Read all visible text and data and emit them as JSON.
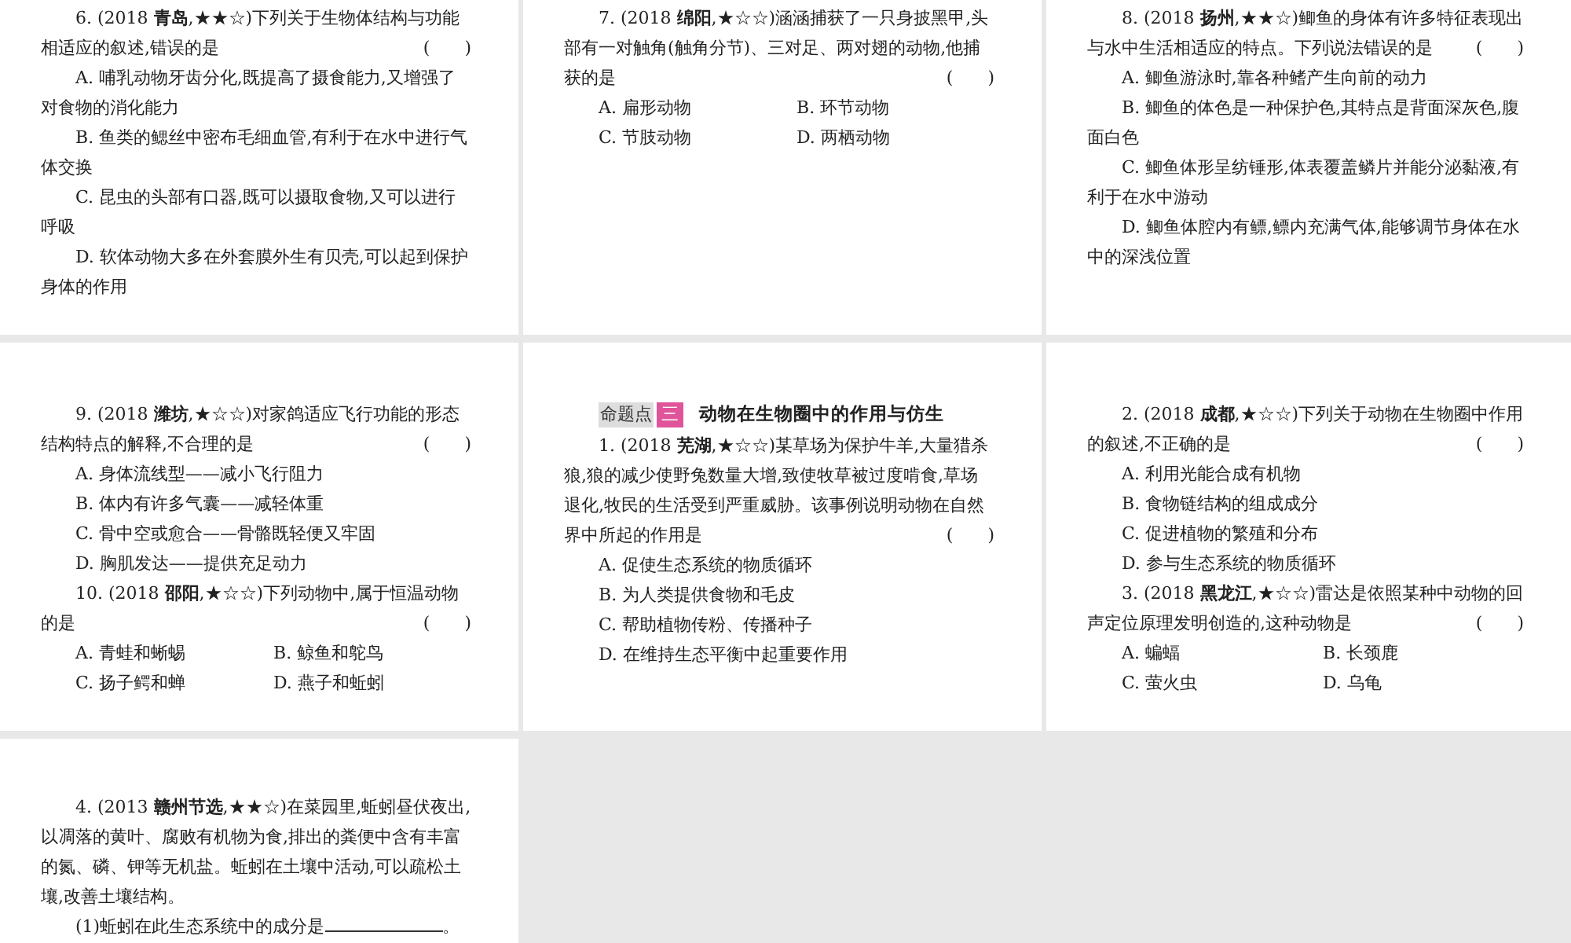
{
  "slides": [
    {
      "items": [
        {
          "kind": "question",
          "text": "6. (2018 **青岛**,★★☆)下列关于生物体结构与功能相适应的叙述,错误的是",
          "bracket": "(　　)"
        },
        {
          "kind": "option",
          "text": "A. 哺乳动物牙齿分化,既提高了摄食能力,又增强了对食物的消化能力"
        },
        {
          "kind": "option",
          "text": "B. 鱼类的鳃丝中密布毛细血管,有利于在水中进行气体交换"
        },
        {
          "kind": "option",
          "text": "C. 昆虫的头部有口器,既可以摄取食物,又可以进行呼吸"
        },
        {
          "kind": "option",
          "text": "D. 软体动物大多在外套膜外生有贝壳,可以起到保护身体的作用"
        }
      ]
    },
    {
      "items": [
        {
          "kind": "question",
          "text": "7. (2018 **绵阳**,★☆☆)涵涵捕获了一只身披黑甲,头部有一对触角(触角分节)、三对足、两对翅的动物,他捕获的是",
          "bracket": "(　　)"
        },
        {
          "kind": "option_pair",
          "left": "A. 扁形动物",
          "right": "B. 环节动物"
        },
        {
          "kind": "option_pair",
          "left": "C. 节肢动物",
          "right": "D. 两栖动物"
        }
      ]
    },
    {
      "items": [
        {
          "kind": "question",
          "text": "8. (2018 **扬州**,★★☆)鲫鱼的身体有许多特征表现出与水中生活相适应的特点。下列说法错误的是",
          "bracket": "(　　)"
        },
        {
          "kind": "option",
          "text": "A. 鲫鱼游泳时,靠各种鳍产生向前的动力"
        },
        {
          "kind": "option",
          "text": "B. 鲫鱼的体色是一种保护色,其特点是背面深灰色,腹面白色"
        },
        {
          "kind": "option",
          "text": "C. 鲫鱼体形呈纺锤形,体表覆盖鳞片并能分泌黏液,有利于在水中游动"
        },
        {
          "kind": "option",
          "text": "D. 鲫鱼体腔内有鳔,鳔内充满气体,能够调节身体在水中的深浅位置"
        }
      ]
    },
    {
      "items": [
        {
          "kind": "question",
          "text": "9. (2018 **潍坊**,★☆☆)对家鸽适应飞行功能的形态结构特点的解释,不合理的是",
          "bracket": "(　　)"
        },
        {
          "kind": "option",
          "text": "A. 身体流线型——减小飞行阻力"
        },
        {
          "kind": "option",
          "text": "B. 体内有许多气囊——减轻体重"
        },
        {
          "kind": "option",
          "text": "C. 骨中空或愈合——骨骼既轻便又牢固"
        },
        {
          "kind": "option",
          "text": "D. 胸肌发达——提供充足动力"
        },
        {
          "kind": "question",
          "text": "10. (2018 **邵阳**,★☆☆)下列动物中,属于恒温动物的是",
          "bracket": "(　　)"
        },
        {
          "kind": "option_pair",
          "left": "A. 青蛙和蜥蜴",
          "right": "B. 鲸鱼和鸵鸟"
        },
        {
          "kind": "option_pair",
          "left": "C. 扬子鳄和蝉",
          "right": "D. 燕子和蚯蚓"
        }
      ]
    },
    {
      "items": [
        {
          "kind": "heading",
          "label": "命题点",
          "number": "三",
          "title": "动物在生物圈中的作用与仿生"
        },
        {
          "kind": "question",
          "text": "1. (2018 **芜湖**,★☆☆)某草场为保护牛羊,大量猎杀狼,狼的减少使野兔数量大增,致使牧草被过度啃食,草场退化,牧民的生活受到严重威胁。该事例说明动物在自然界中所起的作用是",
          "bracket": "(　　)"
        },
        {
          "kind": "option",
          "text": "A. 促使生态系统的物质循环"
        },
        {
          "kind": "option",
          "text": "B. 为人类提供食物和毛皮"
        },
        {
          "kind": "option",
          "text": "C. 帮助植物传粉、传播种子"
        },
        {
          "kind": "option",
          "text": "D. 在维持生态平衡中起重要作用"
        }
      ]
    },
    {
      "items": [
        {
          "kind": "question",
          "text": "2. (2018 **成都**,★☆☆)下列关于动物在生物圈中作用的叙述,不正确的是",
          "bracket": "(　　)"
        },
        {
          "kind": "option",
          "text": "A. 利用光能合成有机物"
        },
        {
          "kind": "option",
          "text": "B. 食物链结构的组成成分"
        },
        {
          "kind": "option",
          "text": "C. 促进植物的繁殖和分布"
        },
        {
          "kind": "option",
          "text": "D. 参与生态系统的物质循环"
        },
        {
          "kind": "question",
          "text": "3. (2018 **黑龙江**,★☆☆)雷达是依照某种中动物的回声定位原理发明创造的,这种动物是",
          "bracket": "(　　)"
        },
        {
          "kind": "option_pair",
          "left": "A. 蝙蝠",
          "right": "B. 长颈鹿"
        },
        {
          "kind": "option_pair",
          "left": "C. 萤火虫",
          "right": "D. 乌龟"
        }
      ]
    },
    {
      "items": [
        {
          "kind": "question",
          "text": "4. (2013 **赣州节选**,★★☆)在菜园里,蚯蚓昼伏夜出,以凋落的黄叶、腐败有机物为食,排出的粪便中含有丰富的氮、磷、钾等无机盐。蚯蚓在土壤中活动,可以疏松土壤,改善土壤结构。"
        },
        {
          "kind": "fill",
          "before": "(1)蚯蚓在此生态系统中的成分是",
          "after": "。"
        }
      ]
    }
  ]
}
